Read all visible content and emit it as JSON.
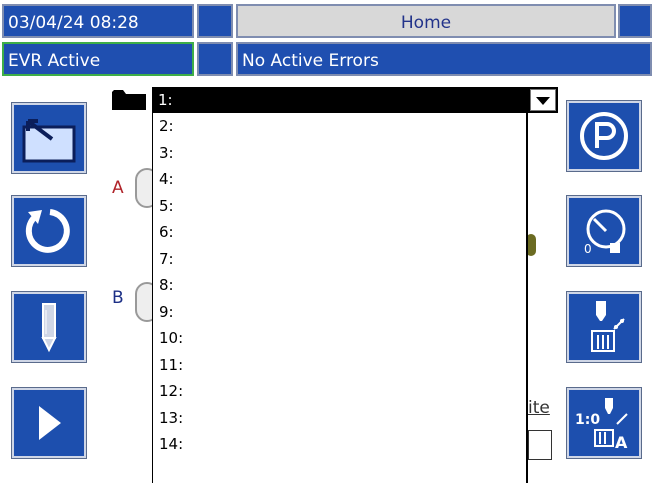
{
  "status_bar": {
    "datetime": "03/04/24 08:28",
    "screen_title": "Home",
    "mode": "EVR Active",
    "errors": "No Active Errors"
  },
  "dropdown": {
    "selected": "1:",
    "items": [
      "2:",
      "3:",
      "4:",
      "5:",
      "6:",
      "7:",
      "8:",
      "9:",
      "10:",
      "11:",
      "12:",
      "13:",
      "14:"
    ]
  },
  "background_labels": {
    "side_a": "A",
    "side_b": "B",
    "partial_text": "ite"
  },
  "icons": {
    "left_buttons": [
      "exit-setup-icon",
      "reset-icon",
      "edit-pencil-icon",
      "play-arrow-icon"
    ],
    "right_buttons": [
      "park-icon",
      "gauge-calibrate-icon",
      "dispense-icon",
      "ratio-dispense-icon"
    ]
  }
}
